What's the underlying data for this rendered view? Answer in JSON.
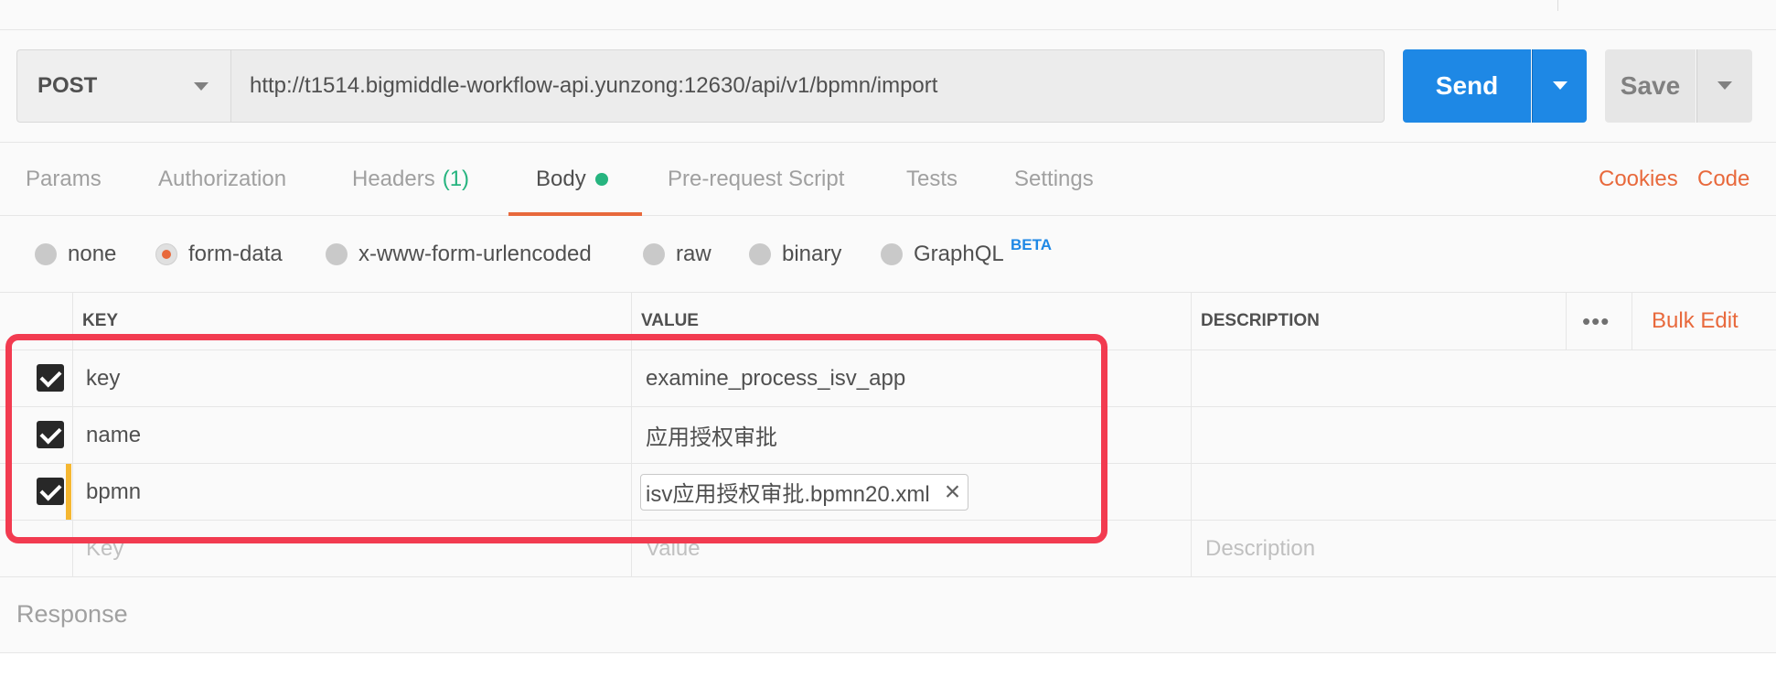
{
  "request": {
    "method": "POST",
    "url": "http://t1514.bigmiddle-workflow-api.yunzong:12630/api/v1/bpmn/import",
    "send_label": "Send",
    "save_label": "Save"
  },
  "tabs": [
    {
      "label": "Params"
    },
    {
      "label": "Authorization"
    },
    {
      "label": "Headers",
      "count": "(1)"
    },
    {
      "label": "Body",
      "active": true
    },
    {
      "label": "Pre-request Script"
    },
    {
      "label": "Tests"
    },
    {
      "label": "Settings"
    }
  ],
  "tab_links": {
    "cookies": "Cookies",
    "code": "Code"
  },
  "body_types": {
    "options": [
      "none",
      "form-data",
      "x-www-form-urlencoded",
      "raw",
      "binary",
      "GraphQL"
    ],
    "selected": "form-data",
    "beta_badge": "BETA"
  },
  "table": {
    "headers": {
      "key": "KEY",
      "value": "VALUE",
      "description": "DESCRIPTION"
    },
    "bulk_edit": "Bulk Edit",
    "more": "•••",
    "rows": [
      {
        "key": "key",
        "value": "examine_process_isv_app",
        "checked": true
      },
      {
        "key": "name",
        "value": "应用授权审批",
        "checked": true
      },
      {
        "key": "bpmn",
        "file": "isv应用授权审批.bpmn20.xml",
        "checked": true
      }
    ],
    "placeholders": {
      "key": "Key",
      "value": "Value",
      "description": "Description"
    }
  },
  "response": {
    "label": "Response"
  },
  "colors": {
    "accent": "#e8693c",
    "send_blue": "#1e88e5",
    "success_green": "#26b47f",
    "highlight_red": "#f23b50"
  }
}
